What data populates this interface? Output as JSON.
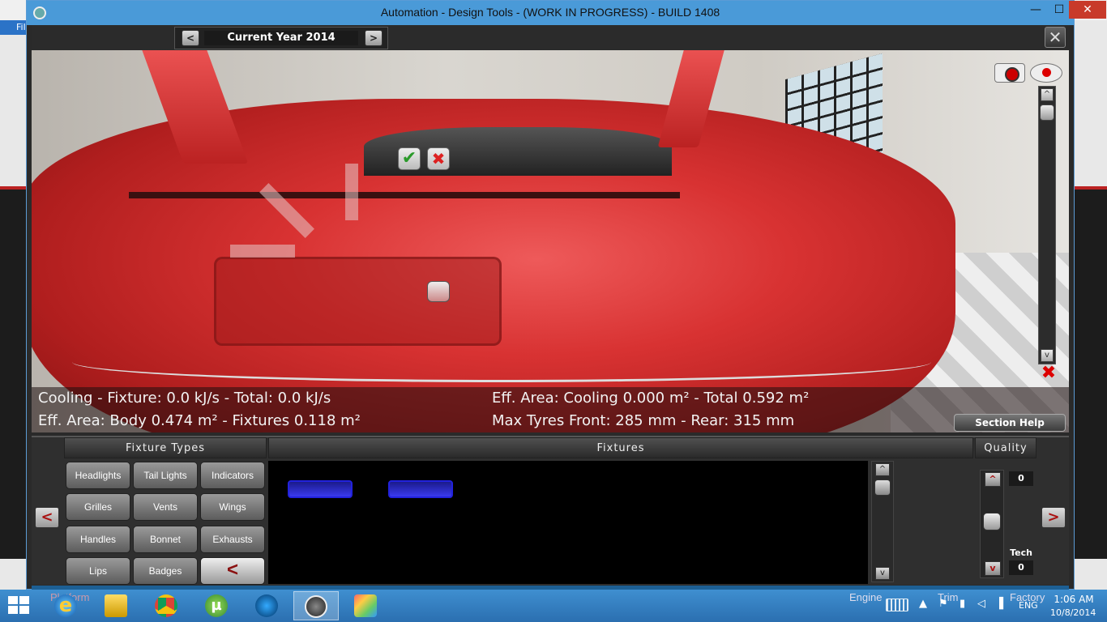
{
  "window": {
    "title": "Automation - Design Tools - (WORK IN PROGRESS) - BUILD 1408",
    "minimize_glyph": "—",
    "maximize_glyph": "☐",
    "close_glyph": "✕"
  },
  "background_app": {
    "tab_label": "Fil"
  },
  "top_bar": {
    "year_label": "Current Year 2014",
    "prev_glyph": "<",
    "next_glyph": ">",
    "close_glyph": "✕"
  },
  "viewport": {
    "confirm_glyph": "✔",
    "cancel_glyph": "✖",
    "zoom_up_glyph": "^",
    "zoom_down_glyph": "v",
    "hide_glyph": "✖"
  },
  "stats": {
    "cooling": "Cooling - Fixture: 0.0 kJ/s - Total: 0.0 kJ/s",
    "eff_area_body": "Eff. Area: Body 0.474 m² - Fixtures 0.118 m²",
    "eff_area_cooling": "Eff. Area: Cooling 0.000 m² - Total 0.592 m²",
    "tyres": "Max Tyres Front: 285 mm - Rear: 315 mm"
  },
  "section_help_label": "Section Help",
  "panel": {
    "fixture_types_header": "Fixture Types",
    "fixtures_header": "Fixtures",
    "quality_header": "Quality",
    "side_left_glyph": "<",
    "side_right_glyph": ">",
    "fixture_types": [
      "Headlights",
      "Tail Lights",
      "Indicators",
      "Grilles",
      "Vents",
      "Wings",
      "Handles",
      "Bonnet",
      "Exhausts",
      "Lips",
      "Badges"
    ],
    "types_back_glyph": "<",
    "fixtures_up_glyph": "^",
    "fixtures_down_glyph": "v",
    "quality_up_glyph": "^",
    "quality_down_glyph": "v",
    "quality_value": "0",
    "tech_label": "Tech",
    "tech_value": "0"
  },
  "nav_tabs": {
    "platform": "Platform",
    "engine": "Engine",
    "trim": "Trim",
    "factory": "Factory"
  },
  "taskbar": {
    "ie_glyph": "e",
    "utorrent_glyph": "µ",
    "tray_up": "▲",
    "tray_flag": "⚑",
    "tray_battery": "▮",
    "tray_speaker": "◁",
    "tray_signal": "▐",
    "language": "ENG",
    "time": "1:06 AM",
    "date": "10/8/2014"
  }
}
